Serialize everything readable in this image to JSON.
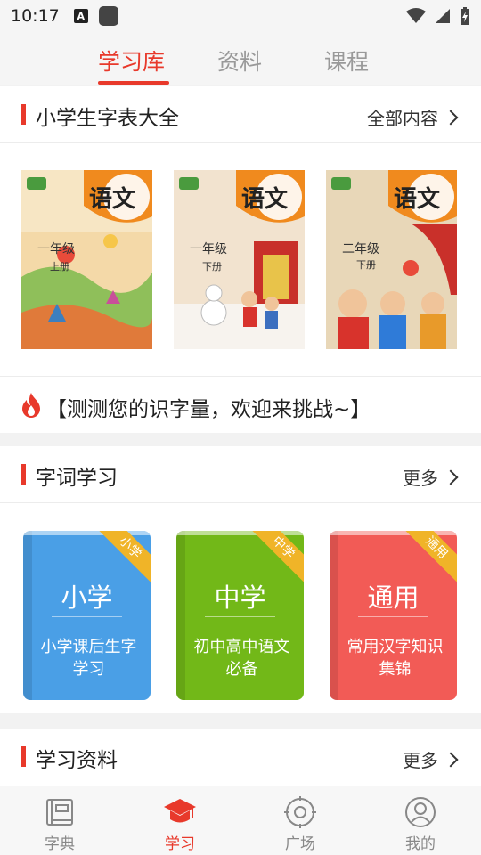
{
  "status_bar": {
    "time": "10:17"
  },
  "top_tabs": [
    {
      "label": "学习库",
      "active": true
    },
    {
      "label": "资料",
      "active": false
    },
    {
      "label": "课程",
      "active": false
    }
  ],
  "textbook_section": {
    "title": "小学生字表大全",
    "more_label": "全部内容",
    "books": [
      {
        "subject": "语文",
        "grade": "一年级",
        "volume": "上册"
      },
      {
        "subject": "语文",
        "grade": "一年级",
        "volume": "下册"
      },
      {
        "subject": "语文",
        "grade": "二年级",
        "volume": "下册"
      }
    ]
  },
  "challenge": {
    "text": "【测测您的识字量，欢迎来挑战~】"
  },
  "word_section": {
    "title": "字词学习",
    "more_label": "更多",
    "cards": [
      {
        "tag": "小学",
        "title": "小学",
        "desc": "小学课后生字学习",
        "color": "#4a9fe6"
      },
      {
        "tag": "中学",
        "title": "中学",
        "desc": "初中高中语文必备",
        "color": "#72b818"
      },
      {
        "tag": "通用",
        "title": "通用",
        "desc": "常用汉字知识集锦",
        "color": "#f25b56"
      }
    ]
  },
  "materials_section": {
    "title": "学习资料",
    "more_label": "更多"
  },
  "bottom_nav": [
    {
      "label": "字典",
      "icon": "book-icon",
      "active": false
    },
    {
      "label": "学习",
      "icon": "graduation-cap-icon",
      "active": true
    },
    {
      "label": "广场",
      "icon": "target-icon",
      "active": false
    },
    {
      "label": "我的",
      "icon": "user-icon",
      "active": false
    }
  ],
  "colors": {
    "accent": "#e8392b"
  }
}
